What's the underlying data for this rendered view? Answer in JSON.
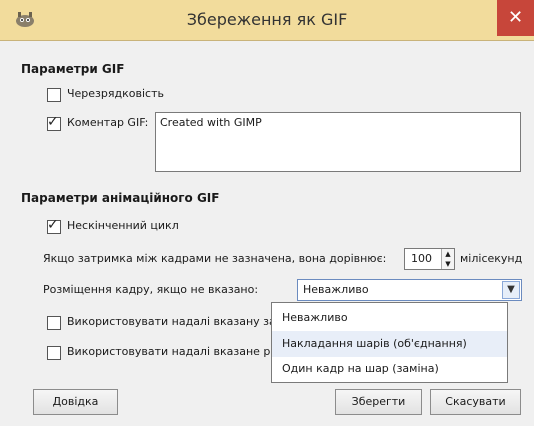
{
  "window": {
    "title": "Збереження як GIF",
    "close_glyph": "✕",
    "app_icon": "gimp-icon"
  },
  "gif_params": {
    "heading": "Параметри GIF",
    "interlace": {
      "label": "Черезрядковість",
      "checked": false
    },
    "comment": {
      "label": "Коментар GIF:",
      "checked": true,
      "value": "Created with GIMP"
    }
  },
  "anim_params": {
    "heading": "Параметри анімаційного GIF",
    "loop": {
      "label": "Нескінченний цикл",
      "checked": true
    },
    "delay": {
      "label": "Якщо затримка між кадрами не зазначена, вона дорівнює:",
      "value": "100",
      "unit": "мілісекунд"
    },
    "disposal": {
      "label": "Розміщення кадру, якщо не вказано:",
      "selected": "Неважливо",
      "options": [
        "Неважливо",
        "Накладання шарів (об'єднання)",
        "Один кадр на шар (заміна)"
      ]
    },
    "use_delay": {
      "label": "Використовувати надалі вказану за",
      "checked": false
    },
    "use_disposal": {
      "label": "Використовувати надалі вказане р",
      "checked": false
    }
  },
  "buttons": {
    "help": "Довідка",
    "save": "Зберегти",
    "cancel": "Скасувати"
  }
}
